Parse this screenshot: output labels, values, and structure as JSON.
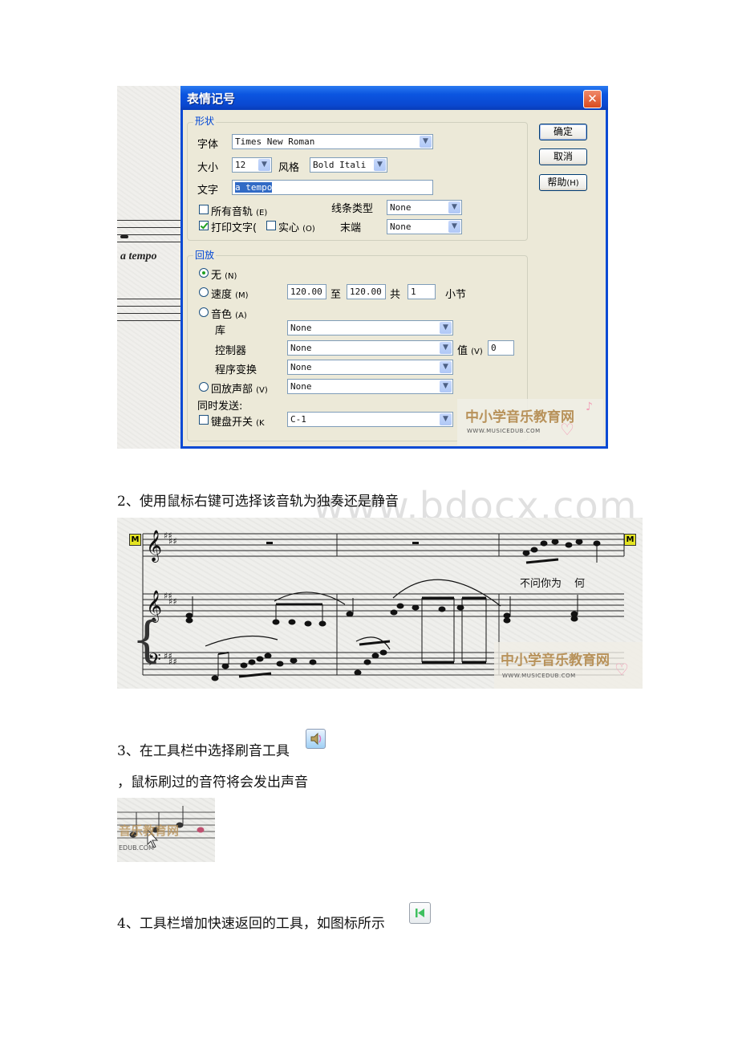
{
  "figure1": {
    "score_fragment": {
      "tempo_marking": "a tempo"
    },
    "dialog": {
      "title": "表情记号",
      "close_icon": "close-x-icon",
      "buttons": {
        "ok": "确定",
        "cancel": "取消",
        "help": "帮助",
        "help_key": "(H)"
      },
      "shape_group": {
        "label": "形状",
        "font_label": "字体",
        "font_value": "Times New Roman",
        "size_label": "大小",
        "size_value": "12",
        "style_label": "风格",
        "style_value": "Bold Itali",
        "text_label": "文字",
        "text_value": "a tempo",
        "all_tracks_label": "所有音轨",
        "all_tracks_key": "(E)",
        "all_tracks_checked": false,
        "print_text_label": "打印文字",
        "print_text_key": "(",
        "print_text_checked": true,
        "solid_label": "实心",
        "solid_key": "(O)",
        "solid_checked": false,
        "line_type_label": "线条类型",
        "line_type_value": "None",
        "end_label": "末端",
        "end_value": "None"
      },
      "playback_group": {
        "label": "回放",
        "none_label": "无",
        "none_key": "(N)",
        "none_selected": true,
        "tempo_label": "速度",
        "tempo_key": "(M)",
        "tempo_from": "120.00",
        "to_label": "至",
        "tempo_to": "120.00",
        "total_label": "共",
        "measures_value": "1",
        "measures_label": "小节",
        "timbre_label": "音色",
        "timbre_key": "(A)",
        "bank_label": "库",
        "bank_value": "None",
        "controller_label": "控制器",
        "controller_value": "None",
        "value_label": "值",
        "value_key": "(V)",
        "value_value": "0",
        "program_label": "程序变换",
        "program_value": "None",
        "voice_label": "回放声部",
        "voice_key": "(V)",
        "voice_value": "None",
        "send_label": "同时发送:",
        "keyswitch_label": "键盘开关",
        "keyswitch_key": "(K",
        "keyswitch_checked": false,
        "keyswitch_value": "C-1"
      },
      "watermark": {
        "cn": "中小学音乐教育网",
        "en": "WWW.MUSICEDUB.COM"
      }
    }
  },
  "paragraphs": {
    "p2": "2、使用鼠标右键可选择该音轨为独奏还是静音",
    "p3a": "3、在工具栏中选择刷音工具",
    "p3b": "，鼠标刷过的音符将会发出声音",
    "p4": "4、工具栏增加快速返回的工具，如图标所示"
  },
  "page_watermark": "www.bdocx.com",
  "figure2": {
    "marker_left": "M",
    "marker_right": "M",
    "lyrics_a": "不问你为",
    "lyrics_b": "何",
    "watermark_cn": "中小学音乐教育网",
    "watermark_en": "WWW.MUSICEDUB.COM"
  },
  "figure3": {
    "watermark_cn": "音乐教育网",
    "watermark_en": "EDUB.COM"
  },
  "icons": {
    "scrub_tool": "speaker-scrub-icon",
    "rewind_tool": "rewind-to-start-icon"
  }
}
